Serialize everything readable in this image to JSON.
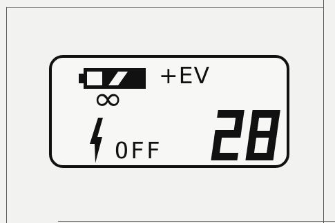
{
  "lcd": {
    "battery_icon": "battery-full-icon",
    "ev_label": "+EV",
    "infinity_symbol": "∞",
    "flash_icon": "flash-icon",
    "flash_status": "OFF",
    "frame_count": "28"
  }
}
